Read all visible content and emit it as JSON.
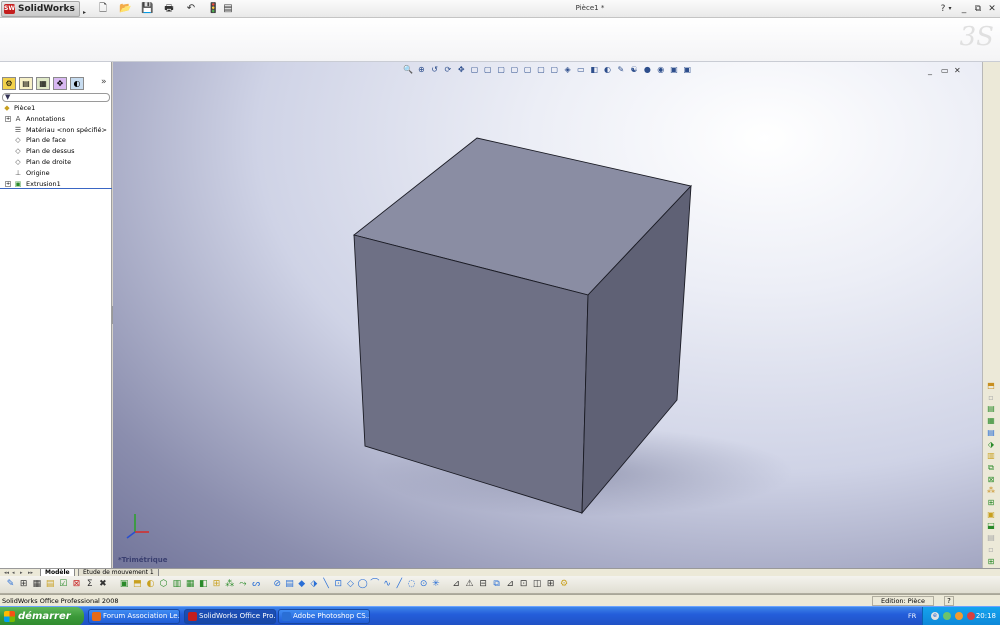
{
  "app": {
    "name": "SolidWorks",
    "logo_mark": "SW",
    "document_title": "Pièce1 *",
    "help_label": "?"
  },
  "quick_access": [
    {
      "name": "new-document-icon",
      "glyph": "🗋"
    },
    {
      "name": "open-icon",
      "glyph": "📂"
    },
    {
      "name": "save-icon",
      "glyph": "💾"
    },
    {
      "name": "print-icon",
      "glyph": "🖶"
    },
    {
      "name": "undo-icon",
      "glyph": "↶"
    },
    {
      "name": "rebuild-icon",
      "glyph": "🚦"
    },
    {
      "name": "options-icon",
      "glyph": "▤"
    }
  ],
  "feature_tree": {
    "tabs": [
      "feature-manager-icon",
      "property-manager-icon",
      "configuration-manager-icon",
      "dimxpert-icon",
      "display-manager-icon"
    ],
    "expand_label": "»",
    "filter_glyph": "▼",
    "items": [
      {
        "label": "Pièce1",
        "icon": "part-icon",
        "glyph": "◆",
        "indent": 0,
        "expand": ""
      },
      {
        "label": "Annotations",
        "icon": "annotations-icon",
        "glyph": "A",
        "indent": 1,
        "expand": "+"
      },
      {
        "label": "Matériau <non spécifié>",
        "icon": "material-icon",
        "glyph": "☰",
        "indent": 1,
        "expand": ""
      },
      {
        "label": "Plan de face",
        "icon": "plane-icon",
        "glyph": "◇",
        "indent": 1,
        "expand": ""
      },
      {
        "label": "Plan de dessus",
        "icon": "plane-icon",
        "glyph": "◇",
        "indent": 1,
        "expand": ""
      },
      {
        "label": "Plan de droite",
        "icon": "plane-icon",
        "glyph": "◇",
        "indent": 1,
        "expand": ""
      },
      {
        "label": "Origine",
        "icon": "origin-icon",
        "glyph": "⊥",
        "indent": 1,
        "expand": ""
      },
      {
        "label": "Extrusion1",
        "icon": "extrude-icon",
        "glyph": "▣",
        "indent": 1,
        "expand": "+"
      }
    ]
  },
  "viewport": {
    "view_name": "*Trimétrique",
    "headsup_icons": [
      "zoom-to-fit-icon",
      "zoom-area-icon",
      "previous-view-icon",
      "rotate-icon",
      "pan-icon",
      "view-front-icon",
      "view-back-icon",
      "view-left-icon",
      "view-right-icon",
      "view-top-icon",
      "view-bottom-icon",
      "view-iso-icon",
      "view-trimetric-icon",
      "view-dimetric-icon",
      "section-view-icon",
      "display-style-icon",
      "hide-show-icon",
      "appearance-icon",
      "scene-icon",
      "shadows-icon",
      "perspective-icon",
      "realview-icon"
    ],
    "headsup_glyphs": [
      "🔍",
      "⊕",
      "↺",
      "⟳",
      "✥",
      "▢",
      "▢",
      "▢",
      "▢",
      "▢",
      "▢",
      "▢",
      "◈",
      "▭",
      "◧",
      "◐",
      "✎",
      "☯",
      "●",
      "◉",
      "▣",
      "▣"
    ],
    "controls": [
      "_",
      "▭",
      "✕"
    ],
    "task_pane": [
      {
        "name": "solidworks-resources-icon",
        "glyph": "⌂"
      },
      {
        "name": "design-library-icon",
        "glyph": "▦"
      },
      {
        "name": "file-explorer-icon",
        "glyph": "▭"
      },
      {
        "name": "search-icon",
        "glyph": "⌕"
      },
      {
        "name": "view-palette-icon",
        "glyph": "◉"
      },
      {
        "name": "appearances-icon",
        "glyph": "◍"
      }
    ],
    "colors": {
      "cube_front": "#6e7085",
      "cube_top": "#8a8da3",
      "cube_right": "#5f6175",
      "edge": "#1a1b24"
    }
  },
  "bottom_tabs": [
    {
      "label": "Modèle",
      "active": true
    },
    {
      "label": "Etude de mouvement 1",
      "active": false
    }
  ],
  "sketch_toolbar": {
    "glyphs": [
      "✎",
      "⊞",
      "▦",
      "▤",
      "☑",
      "⊠",
      "Σ",
      "✖",
      "▣",
      "⬒",
      "◐",
      "⬡",
      "▥",
      "▦",
      "◧",
      "⊞",
      "⁂",
      "⤳",
      "ᔕ",
      "⊘",
      "▤",
      "◆",
      "⬗",
      "╲",
      "⊡",
      "◇",
      "◯",
      "⌒",
      "∿",
      "╱",
      "◌",
      "⊙",
      "✳",
      "⊿",
      "⚠",
      "⊟",
      "⧉",
      "⊿",
      "⊡",
      "◫",
      "⊞",
      "⚙"
    ]
  },
  "status": {
    "left": "SolidWorks Office Professional 2008",
    "mode": "Edition: Pièce",
    "help": "?"
  },
  "taskbar": {
    "start": "démarrer",
    "tasks": [
      {
        "label": "Forum Association Le...",
        "color": "#e66a1a",
        "active": false
      },
      {
        "label": "SolidWorks Office Pro...",
        "color": "#c41e1e",
        "active": true
      },
      {
        "label": "Adobe Photoshop CS...",
        "color": "#2a6fd6",
        "active": false
      }
    ],
    "lang": "FR",
    "clock": "20:18"
  }
}
